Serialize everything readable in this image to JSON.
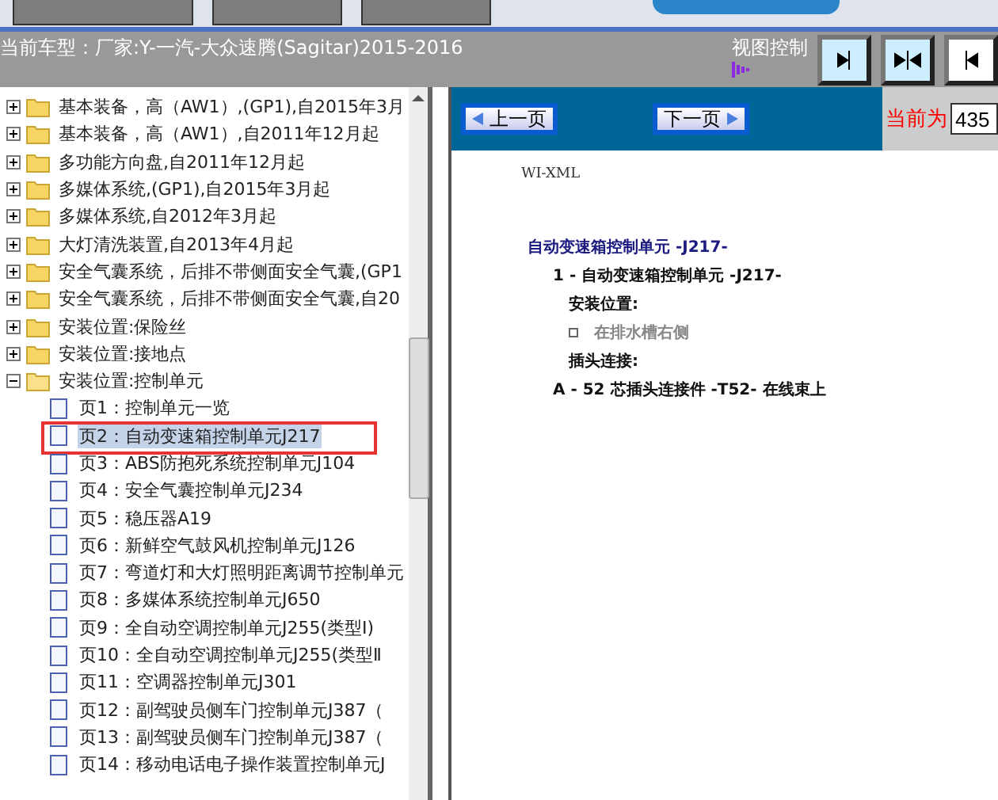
{
  "header": {
    "vehicle": "当前车型：厂家:Y-一汽-大众速腾(Sagitar)2015-2016",
    "view_control_label": "视图控制"
  },
  "tree": [
    {
      "label": "基本装备，高（AW1）,(GP1),自2015年3月",
      "expanded": false
    },
    {
      "label": "基本装备，高（AW1）,自2011年12月起",
      "expanded": false
    },
    {
      "label": "多功能方向盘,自2011年12月起",
      "expanded": false
    },
    {
      "label": "多媒体系统,(GP1),自2015年3月起",
      "expanded": false
    },
    {
      "label": "多媒体系统,自2012年3月起",
      "expanded": false
    },
    {
      "label": "大灯清洗装置,自2013年4月起",
      "expanded": false
    },
    {
      "label": "安全气囊系统，后排不带侧面安全气囊,(GP1",
      "expanded": false
    },
    {
      "label": "安全气囊系统，后排不带侧面安全气囊,自20",
      "expanded": false
    },
    {
      "label": "安装位置:保险丝",
      "expanded": false
    },
    {
      "label": "安装位置:接地点",
      "expanded": false
    },
    {
      "label": "安装位置:控制单元",
      "expanded": true,
      "children": [
        {
          "label": "页1：控制单元一览",
          "selected": false
        },
        {
          "label": "页2：自动变速箱控制单元J217",
          "selected": true
        },
        {
          "label": "页3：ABS防抱死系统控制单元J104",
          "selected": false
        },
        {
          "label": "页4：安全气囊控制单元J234",
          "selected": false
        },
        {
          "label": "页5：稳压器A19",
          "selected": false
        },
        {
          "label": "页6：新鲜空气鼓风机控制单元J126",
          "selected": false
        },
        {
          "label": "页7：弯道灯和大灯照明距离调节控制单元",
          "selected": false
        },
        {
          "label": "页8：多媒体系统控制单元J650",
          "selected": false
        },
        {
          "label": "页9：全自动空调控制单元J255(类型Ⅰ)",
          "selected": false
        },
        {
          "label": "页10：全自动空调控制单元J255(类型Ⅱ",
          "selected": false
        },
        {
          "label": "页11：空调器控制单元J301",
          "selected": false
        },
        {
          "label": "页12：副驾驶员侧车门控制单元J387（",
          "selected": false
        },
        {
          "label": "页13：副驾驶员侧车门控制单元J387（",
          "selected": false
        },
        {
          "label": "页14：移动电话电子操作装置控制单元J",
          "selected": false
        }
      ]
    }
  ],
  "toolbar": {
    "prev": "上一页",
    "next": "下一页",
    "current_label": "当前为",
    "page_value": "435"
  },
  "document": {
    "source": "WI-XML",
    "title": "自动变速箱控制单元 -J217-",
    "lines": [
      {
        "kind": "item",
        "text": "1 - 自动变速箱控制单元 -J217-"
      },
      {
        "kind": "heading",
        "text": "安装位置:"
      },
      {
        "kind": "bullet",
        "text": "在排水槽右侧"
      },
      {
        "kind": "heading",
        "text": "插头连接:"
      },
      {
        "kind": "item",
        "text": "A - 52 芯插头连接件 -T52- 在线束上"
      }
    ]
  }
}
